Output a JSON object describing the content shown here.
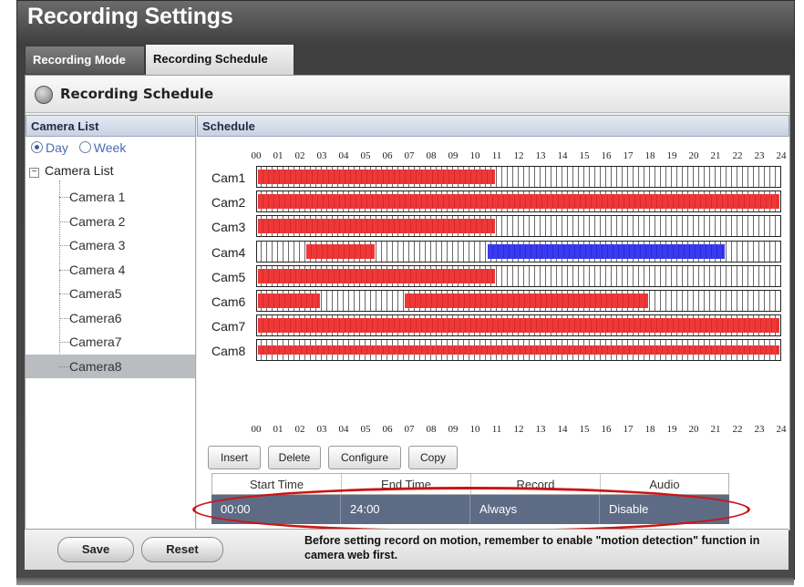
{
  "window": {
    "title": "Recording Settings"
  },
  "tabs": [
    {
      "label": "Recording Mode",
      "active": false
    },
    {
      "label": "Recording Schedule",
      "active": true
    }
  ],
  "section": {
    "title": "Recording Schedule",
    "icon": "camera-lens-icon"
  },
  "camera_list": {
    "header": "Camera List",
    "view_options": [
      {
        "label": "Day",
        "selected": true
      },
      {
        "label": "Week",
        "selected": false
      }
    ],
    "root_label": "Camera List",
    "items": [
      "Camera 1",
      "Camera 2",
      "Camera 3",
      "Camera 4",
      "Camera5",
      "Camera6",
      "Camera7",
      "Camera8"
    ],
    "selected_item": "Camera8"
  },
  "schedule": {
    "header": "Schedule",
    "hours": [
      "00",
      "01",
      "02",
      "03",
      "04",
      "05",
      "06",
      "07",
      "08",
      "09",
      "10",
      "11",
      "12",
      "13",
      "14",
      "15",
      "16",
      "17",
      "18",
      "19",
      "20",
      "21",
      "22",
      "23",
      "24"
    ],
    "cameras": [
      {
        "label": "Cam1",
        "segments": [
          {
            "start": 0,
            "end": 11,
            "color": "red"
          }
        ]
      },
      {
        "label": "Cam2",
        "segments": [
          {
            "start": 0,
            "end": 24,
            "color": "red"
          }
        ]
      },
      {
        "label": "Cam3",
        "segments": [
          {
            "start": 0,
            "end": 11,
            "color": "red"
          }
        ]
      },
      {
        "label": "Cam4",
        "segments": [
          {
            "start": 2.2,
            "end": 5.5,
            "color": "red"
          },
          {
            "start": 10.5,
            "end": 21.5,
            "color": "blue"
          }
        ]
      },
      {
        "label": "Cam5",
        "segments": [
          {
            "start": 0,
            "end": 11,
            "color": "red"
          }
        ]
      },
      {
        "label": "Cam6",
        "segments": [
          {
            "start": 0,
            "end": 3,
            "color": "red"
          },
          {
            "start": 6.7,
            "end": 18,
            "color": "red"
          }
        ]
      },
      {
        "label": "Cam7",
        "segments": [
          {
            "start": 0,
            "end": 24,
            "color": "red"
          }
        ]
      },
      {
        "label": "Cam8",
        "segments": [
          {
            "start": 0,
            "end": 24,
            "color": "red"
          }
        ]
      }
    ],
    "colors": {
      "red": "#ee3838",
      "blue": "#3a3af0"
    },
    "buttons": {
      "insert": "Insert",
      "delete": "Delete",
      "configure": "Configure",
      "copy": "Copy"
    },
    "table": {
      "columns": [
        "Start Time",
        "End Time",
        "Record",
        "Audio"
      ],
      "rows": [
        [
          "00:00",
          "24:00",
          "Always",
          "Disable"
        ]
      ]
    }
  },
  "footer": {
    "save": "Save",
    "reset": "Reset",
    "note": "Before setting record on motion, remember to enable \"motion detection\" function in camera web first."
  }
}
